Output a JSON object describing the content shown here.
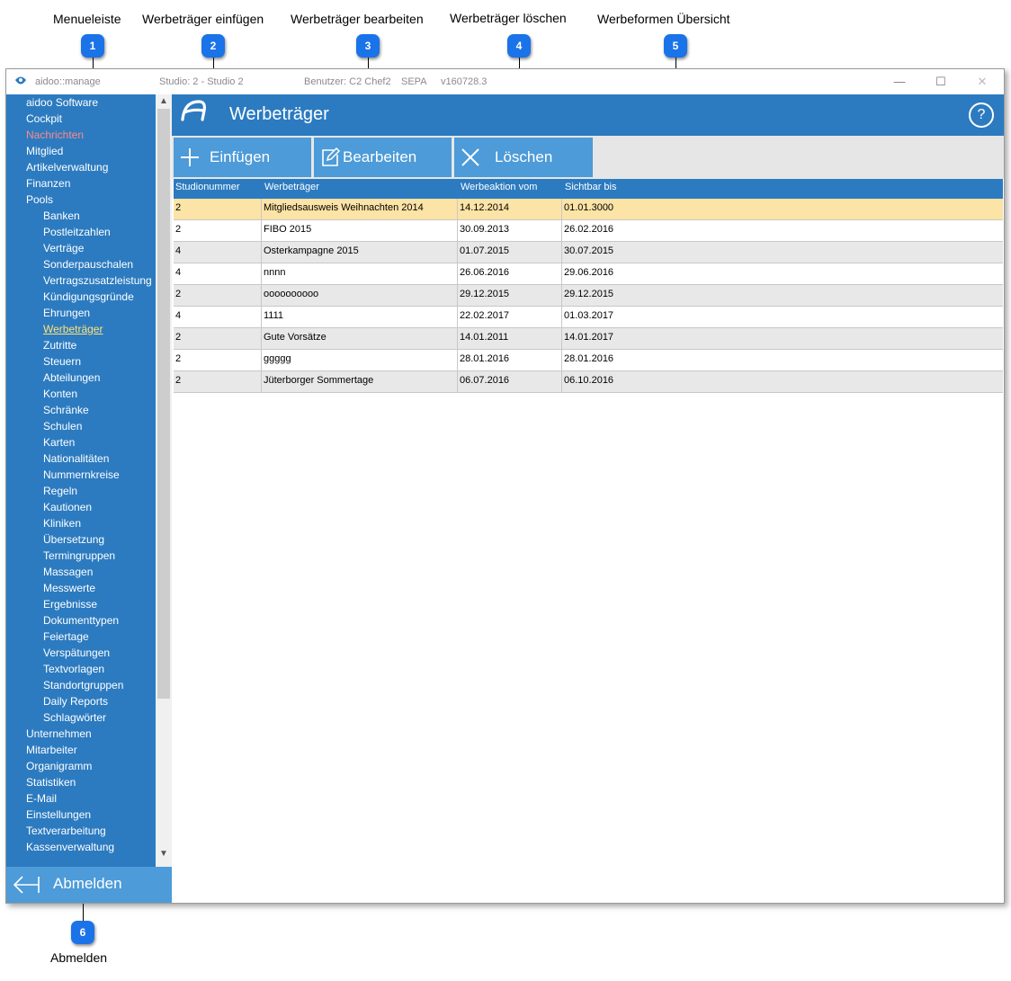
{
  "annotations": [
    {
      "number": "1",
      "label": "Menueleiste"
    },
    {
      "number": "2",
      "label": "Werbeträger einfügen"
    },
    {
      "number": "3",
      "label": "Werbeträger bearbeiten"
    },
    {
      "number": "4",
      "label": "Werbeträger löschen"
    },
    {
      "number": "5",
      "label": "Werbeformen Übersicht"
    },
    {
      "number": "6",
      "label": "Abmelden"
    }
  ],
  "window": {
    "app_name": "aidoo::manage",
    "studio": "Studio: 2 - Studio 2",
    "user": "Benutzer: C2 Chef2",
    "mode": "SEPA",
    "version": "v160728.3",
    "minimize": "—",
    "maximize": "☐",
    "close": "✕"
  },
  "sidebar": {
    "items": [
      {
        "label": "aidoo Software",
        "level": 0
      },
      {
        "label": "Cockpit",
        "level": 0
      },
      {
        "label": "Nachrichten",
        "level": 0,
        "state": "alert"
      },
      {
        "label": "Mitglied",
        "level": 0
      },
      {
        "label": "Artikelverwaltung",
        "level": 0
      },
      {
        "label": "Finanzen",
        "level": 0
      },
      {
        "label": "Pools",
        "level": 0
      },
      {
        "label": "Banken",
        "level": 1
      },
      {
        "label": "Postleitzahlen",
        "level": 1
      },
      {
        "label": "Verträge",
        "level": 1
      },
      {
        "label": "Sonderpauschalen",
        "level": 1
      },
      {
        "label": "Vertragszusatzleistung",
        "level": 1
      },
      {
        "label": "Kündigungsgründe",
        "level": 1
      },
      {
        "label": "Ehrungen",
        "level": 1
      },
      {
        "label": "Werbeträger",
        "level": 1,
        "state": "active"
      },
      {
        "label": "Zutritte",
        "level": 1
      },
      {
        "label": "Steuern",
        "level": 1
      },
      {
        "label": "Abteilungen",
        "level": 1
      },
      {
        "label": "Konten",
        "level": 1
      },
      {
        "label": "Schränke",
        "level": 1
      },
      {
        "label": "Schulen",
        "level": 1
      },
      {
        "label": "Karten",
        "level": 1
      },
      {
        "label": "Nationalitäten",
        "level": 1
      },
      {
        "label": "Nummernkreise",
        "level": 1
      },
      {
        "label": "Regeln",
        "level": 1
      },
      {
        "label": "Kautionen",
        "level": 1
      },
      {
        "label": "Kliniken",
        "level": 1
      },
      {
        "label": "Übersetzung",
        "level": 1
      },
      {
        "label": "Termingruppen",
        "level": 1
      },
      {
        "label": "Massagen",
        "level": 1
      },
      {
        "label": "Messwerte",
        "level": 1
      },
      {
        "label": "Ergebnisse",
        "level": 1
      },
      {
        "label": "Dokumenttypen",
        "level": 1
      },
      {
        "label": "Feiertage",
        "level": 1
      },
      {
        "label": "Verspätungen",
        "level": 1
      },
      {
        "label": "Textvorlagen",
        "level": 1
      },
      {
        "label": "Standortgruppen",
        "level": 1
      },
      {
        "label": "Daily Reports",
        "level": 1
      },
      {
        "label": "Schlagwörter",
        "level": 1
      },
      {
        "label": "Unternehmen",
        "level": 0
      },
      {
        "label": "Mitarbeiter",
        "level": 0
      },
      {
        "label": "Organigramm",
        "level": 0
      },
      {
        "label": "Statistiken",
        "level": 0
      },
      {
        "label": "E-Mail",
        "level": 0
      },
      {
        "label": "Einstellungen",
        "level": 0
      },
      {
        "label": "Textverarbeitung",
        "level": 0
      },
      {
        "label": "Kassenverwaltung",
        "level": 0
      }
    ],
    "logout_label": "Abmelden"
  },
  "header": {
    "title": "Werbeträger",
    "help": "?"
  },
  "toolbar": {
    "insert_label": "Einfügen",
    "edit_label": "Bearbeiten",
    "delete_label": "Löschen"
  },
  "table": {
    "columns": [
      "Studionummer",
      "Werbeträger",
      "Werbeaktion vom",
      "Sichtbar bis"
    ],
    "rows": [
      [
        "2",
        "Mitgliedsausweis Weihnachten 2014",
        "14.12.2014",
        "01.01.3000"
      ],
      [
        "2",
        "FIBO 2015",
        "30.09.2013",
        "26.02.2016"
      ],
      [
        "4",
        "Osterkampagne 2015",
        "01.07.2015",
        "30.07.2015"
      ],
      [
        "4",
        "nnnn",
        "26.06.2016",
        "29.06.2016"
      ],
      [
        "2",
        "oooooooooo",
        "29.12.2015",
        "29.12.2015"
      ],
      [
        "4",
        "1111",
        "22.02.2017",
        "01.03.2017"
      ],
      [
        "2",
        "Gute Vorsätze",
        "14.01.2011",
        "14.01.2017"
      ],
      [
        "2",
        "ggggg",
        "28.01.2016",
        "28.01.2016"
      ],
      [
        "2",
        "Jüterborger Sommertage",
        "06.07.2016",
        "06.10.2016"
      ]
    ],
    "selected_row": 0
  },
  "colors": {
    "accent": "#2c7bc0",
    "button": "#4d9bd8",
    "selected_row": "#fce3a6",
    "alt_row": "#e8e8e8",
    "badge": "#1a73e8"
  }
}
